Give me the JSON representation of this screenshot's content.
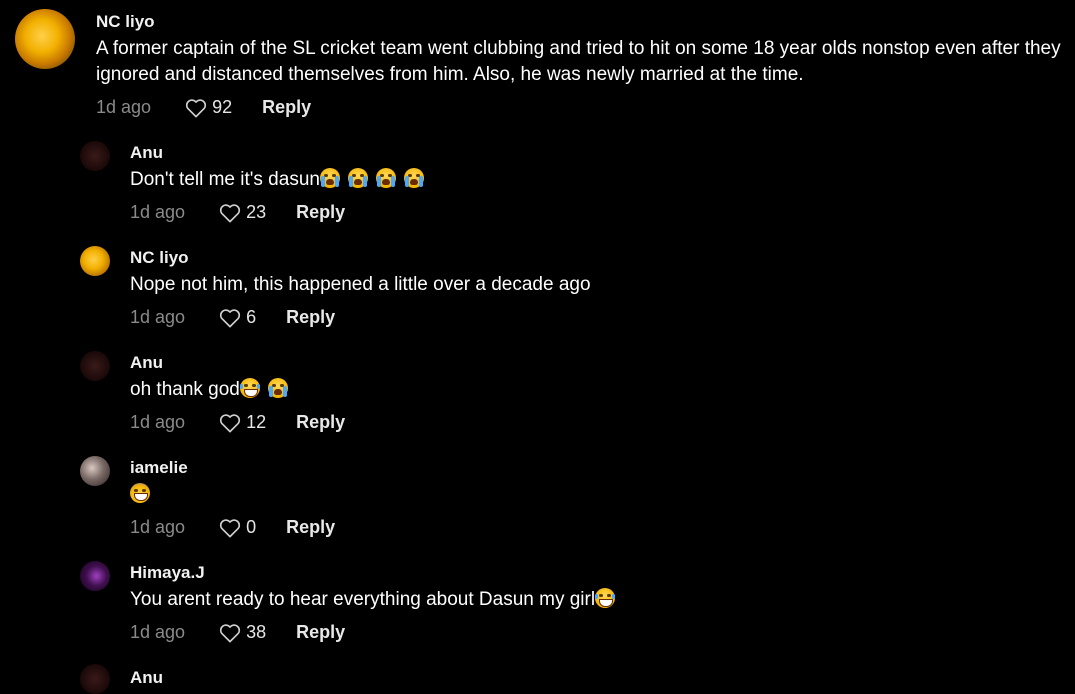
{
  "comments": [
    {
      "username": "NC liyo",
      "text": "A former captain of the SL cricket team went clubbing and tried to hit on some 18 year olds nonstop even after they ignored and distanced themselves from him. Also, he was newly married at the time.",
      "time": "1d ago",
      "likes": "92",
      "reply": "Reply"
    },
    {
      "username": "Anu",
      "text": "Don't tell me it's dasun",
      "emojis": [
        "loudly-crying-face",
        "loudly-crying-face",
        "loudly-crying-face",
        "loudly-crying-face"
      ],
      "time": "1d ago",
      "likes": "23",
      "reply": "Reply"
    },
    {
      "username": "NC liyo",
      "text": "Nope not him, this happened a little over a decade ago",
      "time": "1d ago",
      "likes": "6",
      "reply": "Reply"
    },
    {
      "username": "Anu",
      "text": "oh thank god",
      "emojis": [
        "tears-of-joy-face",
        "loudly-crying-face"
      ],
      "time": "1d ago",
      "likes": "12",
      "reply": "Reply"
    },
    {
      "username": "iamelie",
      "text": "",
      "emojis": [
        "grinning-sweat-face"
      ],
      "time": "1d ago",
      "likes": "0",
      "reply": "Reply"
    },
    {
      "username": "Himaya.J",
      "text": "You arent ready to hear everything about Dasun my girl",
      "emojis": [
        "tears-of-joy-face"
      ],
      "time": "1d ago",
      "likes": "38",
      "reply": "Reply"
    },
    {
      "username": "Anu",
      "text": "",
      "time": "",
      "likes": "",
      "reply": ""
    }
  ],
  "icons": {
    "like": "heart-outline-icon"
  },
  "colors": {
    "background": "#000000",
    "text": "#ffffff",
    "muted": "#8a8a8a"
  }
}
